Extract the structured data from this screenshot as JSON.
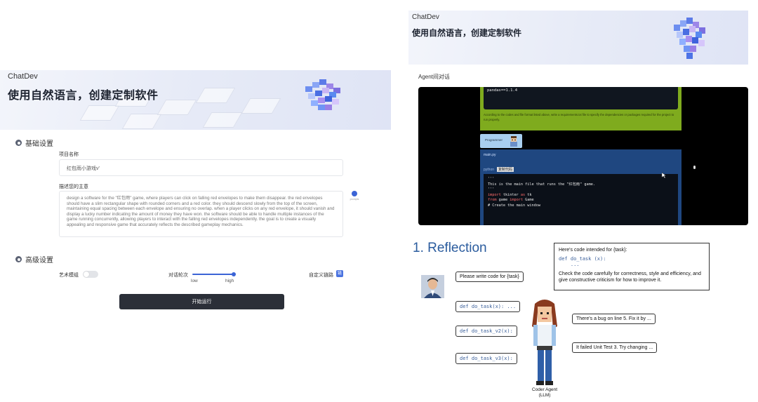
{
  "left": {
    "app_name": "ChatDev",
    "title": "使用自然语言，创建定制软件",
    "basic_section": "基础设置",
    "project_name_label": "项目名称",
    "project_name_value": "红包雨小游戏v'",
    "describe_label": "描述您的主意",
    "describe_value": "design a software for the \"红包雨\" game, where players can click on falling red envelopes to make them disappear. the red envelopes should have a slim rectangular shape with rounded corners and a red color. they should descend slowly from the top of the screen, maintaining equal spacing between each envelope and ensuring no overlap. when a player clicks on any red envelope, it should vanish and display a lucky number indicating the amount of money they have won. the software should be able to handle multiple instances of the game running concurrently, allowing players to interact with the falling red envelopes independently. the goal is to create a visually appealing and responsive game that accurately reflects the described gameplay mechanics.",
    "prompt_enhance_label": "prompts",
    "advanced_section": "高级设置",
    "art_mode_label": "艺术模组",
    "dialog_rounds_label": "对话轮次",
    "slider_low": "low",
    "slider_high": "high",
    "slider_value": 1.0,
    "custom_link_label": "自定义链路",
    "custom_link_icon_text": "链",
    "run_button": "开始运行"
  },
  "right_top": {
    "app_name": "ChatDev",
    "title": "使用自然语言，创建定制软件",
    "dialog_label": "Agent间对话",
    "green_code": "pandas==1.1.4",
    "green_text": "According to the codes and file format listed above, write a requirements.txt file to specify the dependencies or packages required for the project to run properly.",
    "programmer": "Programmer",
    "code_file": "main.py",
    "code_lang": "python",
    "copy_label": "复制代码",
    "code_lines": [
      "'''",
      "This is the main file that runs the \"红包雨\" game.",
      "'''",
      "",
      "import tkinter as tk",
      "from game import Game",
      "",
      "# Create the main window"
    ]
  },
  "reflection": {
    "title": "1. Reflection",
    "task_intro": "Here's code intended for {task}:",
    "task_code_1": "def do_task (x):",
    "task_code_2": "    ...",
    "task_instruction": "Check the code carefully for correctness, style and efficiency, and give constructive criticism for how to improve it.",
    "user_prompt": "Please write code for {task}",
    "code_v1": "def do_task(x): ...",
    "code_v2": "def do_task_v2(x):",
    "code_v3": "def do_task_v3(x):",
    "feedback_1": "There's a bug on line 5. Fix it by ...",
    "feedback_2": "It failed Unit Test 3. Try changing ...",
    "agent_label_1": "Coder Agent",
    "agent_label_2": "(LLM)"
  },
  "colors": {
    "accent": "#3b64d6",
    "run_button": "#2b2f38",
    "green_card": "#7fab1e",
    "code_card": "#1f4780",
    "reflection_title": "#2b5c9e"
  }
}
